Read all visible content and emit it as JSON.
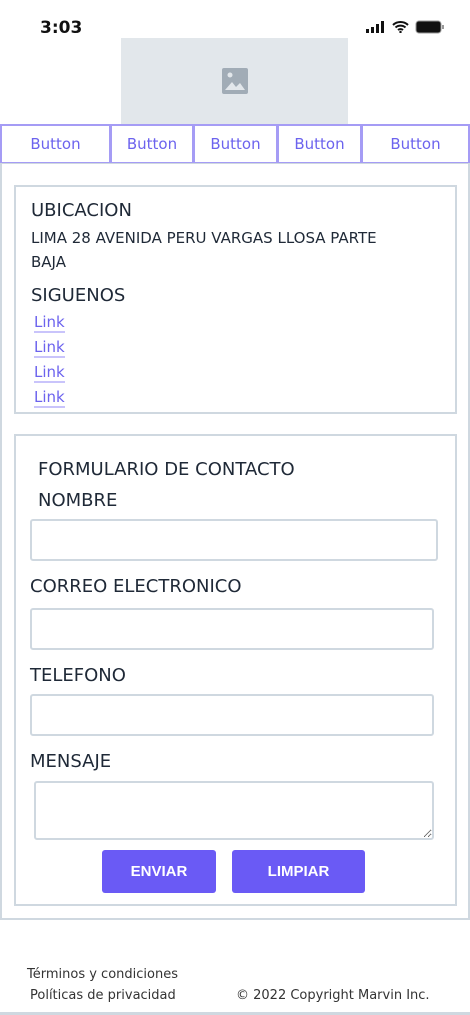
{
  "status_bar": {
    "time": "3:03"
  },
  "nav": {
    "buttons": [
      "Button",
      "Button",
      "Button",
      "Button",
      "Button"
    ]
  },
  "location": {
    "title": "UBICACION",
    "address_line1": "LIMA 28 AVENIDA PERU VARGAS LLOSA PARTE",
    "address_line2": "BAJA",
    "follow_title": "SIGUENOS",
    "links": [
      "Link",
      "Link",
      "Link",
      "Link"
    ]
  },
  "form": {
    "title": "FORMULARIO DE CONTACTO",
    "name_label": "NOMBRE",
    "email_label": "CORREO ELECTRONICO",
    "phone_label": "TELEFONO",
    "message_label": "MENSAJE",
    "name_value": "",
    "email_value": "",
    "phone_value": "",
    "message_value": "",
    "submit_label": "ENVIAR",
    "clear_label": "LIMPIAR"
  },
  "footer": {
    "terms": "Términos y condiciones",
    "privacy": "Políticas de privacidad",
    "copyright": "© 2022 Copyright Marvin Inc."
  },
  "colors": {
    "accent": "#6a5af5",
    "border": "#cfd8e0"
  }
}
